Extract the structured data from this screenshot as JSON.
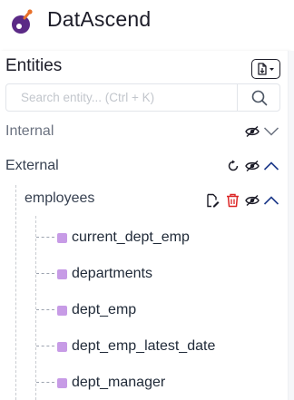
{
  "app": {
    "title": "DatAscend"
  },
  "entities": {
    "title": "Entities",
    "search": {
      "placeholder": "Search entity... (Ctrl + K)",
      "value": ""
    }
  },
  "groups": [
    {
      "label": "Internal"
    },
    {
      "label": "External"
    }
  ],
  "schema": {
    "label": "employees",
    "tables": [
      {
        "label": "current_dept_emp"
      },
      {
        "label": "departments"
      },
      {
        "label": "dept_emp"
      },
      {
        "label": "dept_emp_latest_date"
      },
      {
        "label": "dept_manager"
      }
    ]
  },
  "colors": {
    "accent_navy": "#1e3a8a",
    "delete_red": "#dc2626",
    "table_square": "#c79be6",
    "logo_orange": "#e8702a",
    "logo_purple": "#5b2a86"
  }
}
